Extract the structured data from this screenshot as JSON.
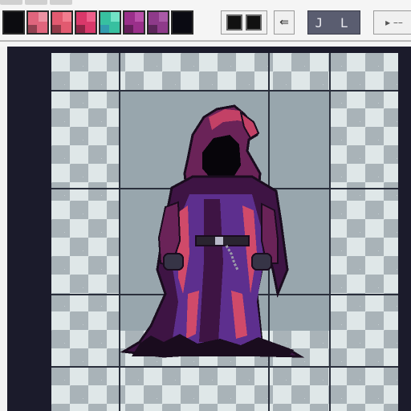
{
  "palette": {
    "colors": [
      "#0c0c10",
      "#e0657d",
      "#e25a70",
      "#d9386a",
      "#37c0a0",
      "#9a2f8a",
      "#8e3a8a",
      "#0a0a12"
    ]
  },
  "toolbar": {
    "jl_label": "J L"
  },
  "canvas": {
    "sprite_subject": "hooded-cloaked-figure",
    "sprite_colors": {
      "outline": "#1a0c1e",
      "robe_dark": "#3e1444",
      "robe_mid": "#6a2358",
      "robe_purple": "#5d2f8e",
      "robe_highlight": "#d04a6a",
      "hood_tip": "#c34166",
      "belt": "#2a2430",
      "buckle": "#b8b8c8",
      "gloves": "#363446"
    }
  }
}
